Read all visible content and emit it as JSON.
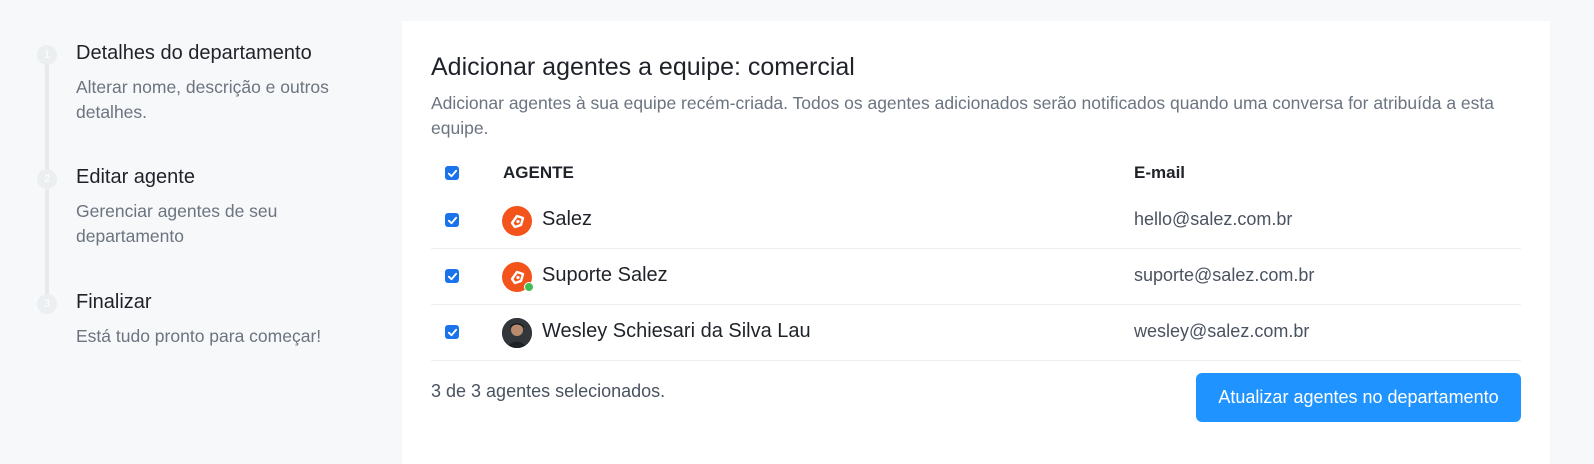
{
  "steps": [
    {
      "number": "1",
      "title": "Detalhes do departamento",
      "description": "Alterar nome, descrição e outros detalhes."
    },
    {
      "number": "2",
      "title": "Editar agente",
      "description": "Gerenciar agentes de seu departamento"
    },
    {
      "number": "3",
      "title": "Finalizar",
      "description": "Está tudo pronto para começar!"
    }
  ],
  "panel": {
    "title": "Adicionar agentes a equipe: comercial",
    "description": "Adicionar agentes à sua equipe recém-criada. Todos os agentes adicionados serão notificados quando uma conversa for atribuída a esta equipe."
  },
  "table": {
    "headers": {
      "agent": "AGENTE",
      "email": "E-mail"
    },
    "select_all_checked": true,
    "rows": [
      {
        "name": "Salez",
        "email": "hello@salez.com.br",
        "checked": true,
        "avatar": "salez-logo-icon",
        "online": false
      },
      {
        "name": "Suporte Salez",
        "email": "suporte@salez.com.br",
        "checked": true,
        "avatar": "salez-logo-icon",
        "online": true
      },
      {
        "name": "Wesley Schiesari da Silva Lau",
        "email": "wesley@salez.com.br",
        "checked": true,
        "avatar": "user-photo",
        "online": false
      }
    ]
  },
  "footer": {
    "selected_count": "3 de 3 agentes selecionados.",
    "update_button": "Atualizar agentes no departamento"
  },
  "colors": {
    "accent": "#1f93ff",
    "brand": "#f2541b",
    "online": "#3fbf53"
  }
}
